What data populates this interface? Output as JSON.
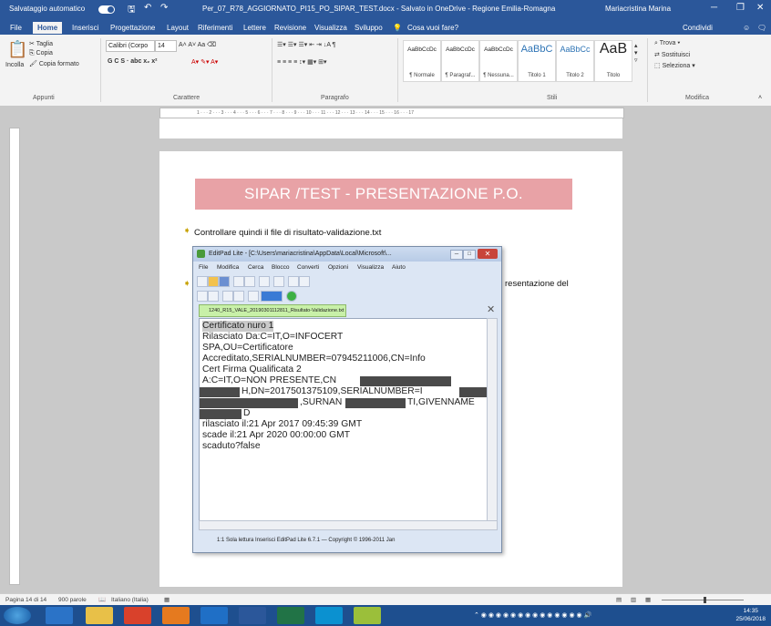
{
  "titlebar": {
    "autosave": "Salvataggio automatico",
    "document": "Per_07_R78_AGGIORNATO_PI15_PO_SIPAR_TEST.docx - Salvato in OneDrive - Regione Emilia-Romagna",
    "user": "Mariacristina Marina"
  },
  "ribbon_tabs": [
    "File",
    "Home",
    "Inserisci",
    "Progettazione",
    "Layout",
    "Riferimenti",
    "Lettere",
    "Revisione",
    "Visualizza",
    "Sviluppo"
  ],
  "tell_me": "Cosa vuoi fare?",
  "share": "Condividi",
  "ribbon": {
    "paste": "Incolla",
    "cut": "Taglia",
    "copy": "Copia",
    "format_painter": "Copia formato",
    "font_name": "Calibri (Corpo",
    "font_size": "14",
    "format_row": "G  C  S  ·  abc  x₂  x²",
    "groups": {
      "clipboard": "Appunti",
      "font": "Carattere",
      "paragraph": "Paragrafo",
      "styles": "Stili",
      "editing": "Modifica"
    },
    "styles": [
      {
        "preview": "AaBbCcDc",
        "name": "¶ Normale"
      },
      {
        "preview": "AaBbCcDc",
        "name": "¶ Paragraf..."
      },
      {
        "preview": "AaBbCcDc",
        "name": "¶ Nessuna..."
      },
      {
        "preview": "AaBbC",
        "name": "Titolo 1"
      },
      {
        "preview": "AaBbCc",
        "name": "Titolo 2"
      },
      {
        "preview": "AaB",
        "name": "Titolo"
      }
    ],
    "find": "Trova",
    "replace": "Sostituisci",
    "select": "Seleziona"
  },
  "ruler_text": "1 · · · 2 · · · 3 · · · 4 · · · 5 · · · 6 · · · 7 · · · 8 · · · 9 · · · 10 · · · 11 · · · 12 · · · 13 · · · 14 · · · 15 · · · 16 · · · 17",
  "document": {
    "banner": "SIPAR /TEST -  PRESENTAZIONE P.O.",
    "line1": "Controllare quindi il file di risultato-validazione.txt",
    "line2_tail": "resentazione del"
  },
  "editpad": {
    "title": "EditPad Lite - [C:\\Users\\mariacristina\\AppData\\Local\\Microsoft\\...",
    "menu": [
      "File",
      "Modifica",
      "Cerca",
      "Blocco",
      "Converti",
      "Opzioni",
      "Visualizza",
      "Aiuto"
    ],
    "file_tab": "1240_R15_VALE_20190301112811_Risultato-Validazione.txt",
    "lines": [
      "Certificato nuro 1",
      "Rilasciato Da:C=IT,O=INFOCERT",
      "SPA,OU=Certificatore",
      "Accreditato,SERIALNUMBER=07945211006,CN=Info",
      "Cert Firma Qualificata 2",
      "A:C=IT,O=NON PRESENTE,CN",
      "H,DN=2017501375109,SERIALNUMBER=I",
      ",SURNAN",
      "TI,GIVENNAME",
      "D",
      "rilasciato il:21 Apr 2017 09:45:39 GMT",
      "scade il:21 Apr 2020 00:00:00 GMT",
      "scaduto?false"
    ],
    "status": "1:1        Sola lettura   Inserisci   EditPad Lite 6.7.1  —  Copyright © 1996-2011 Jan"
  },
  "statusbar": {
    "page": "Pagina 14 di 14",
    "words": "900 parole",
    "language": "Italiano (Italia)"
  },
  "taskbar": {
    "time": "14:35",
    "date": "25/06/2018"
  },
  "colors": {
    "word_blue": "#2b579a",
    "banner": "#e8a2a6",
    "taskbar": "#1e4f8f"
  }
}
